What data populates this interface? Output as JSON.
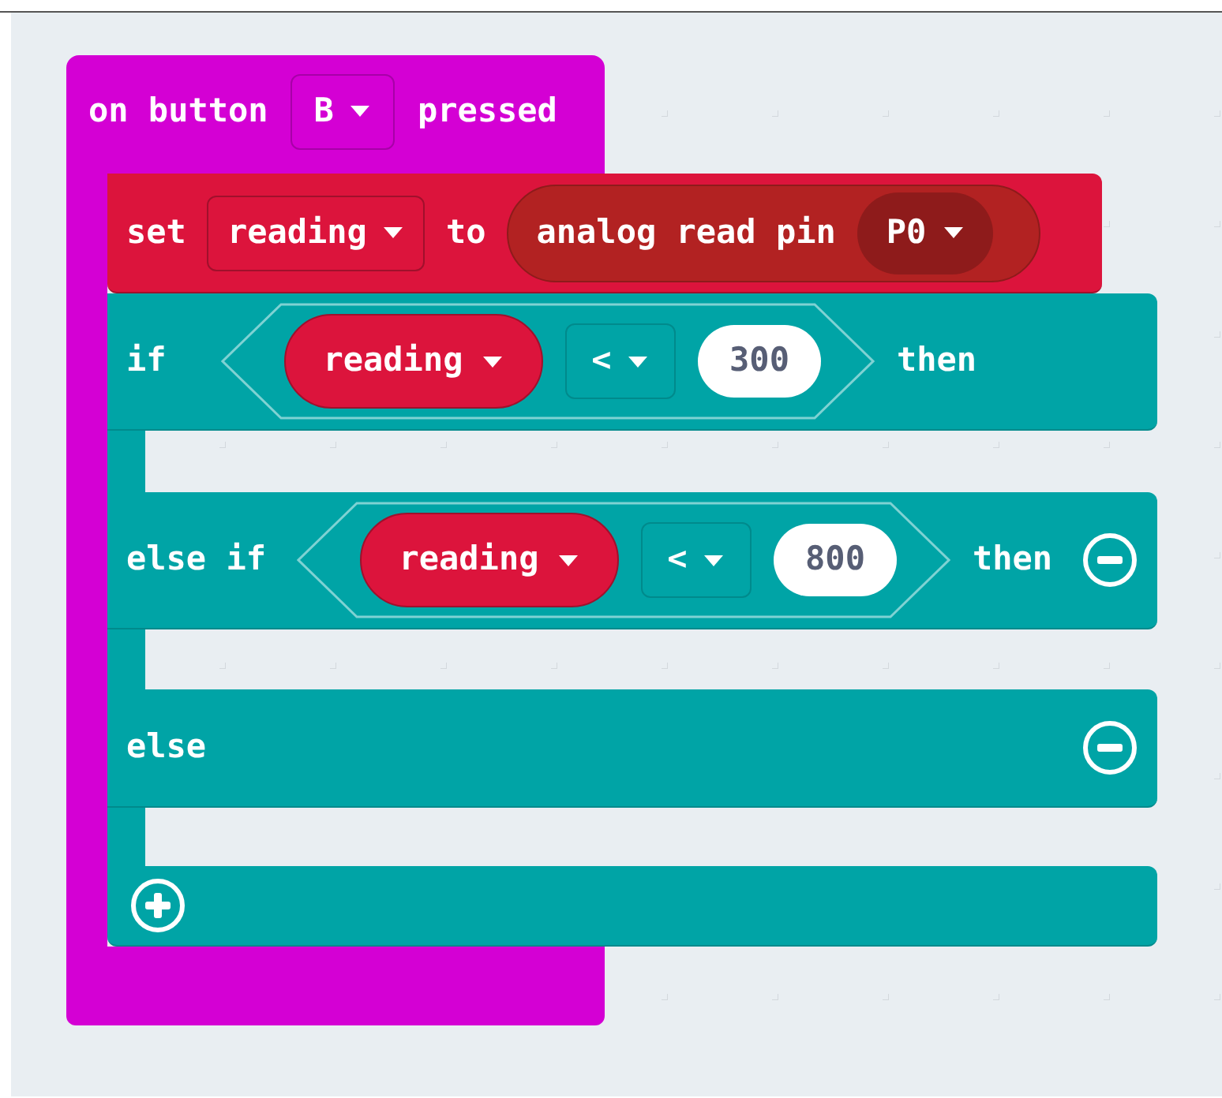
{
  "event": {
    "label_start": "on button",
    "button": "B",
    "label_end": "pressed"
  },
  "set_block": {
    "label": "set",
    "variable": "reading",
    "label_to": "to",
    "value": {
      "label": "analog read pin",
      "pin": "P0"
    }
  },
  "branches": [
    {
      "kind": "condition",
      "keyword": "if",
      "variable": "reading",
      "operator": "<",
      "number": "300",
      "label_then": "then",
      "removable": false
    },
    {
      "kind": "condition",
      "keyword": "else if",
      "variable": "reading",
      "operator": "<",
      "number": "800",
      "label_then": "then",
      "removable": true
    },
    {
      "kind": "else",
      "keyword": "else",
      "removable": true
    }
  ]
}
